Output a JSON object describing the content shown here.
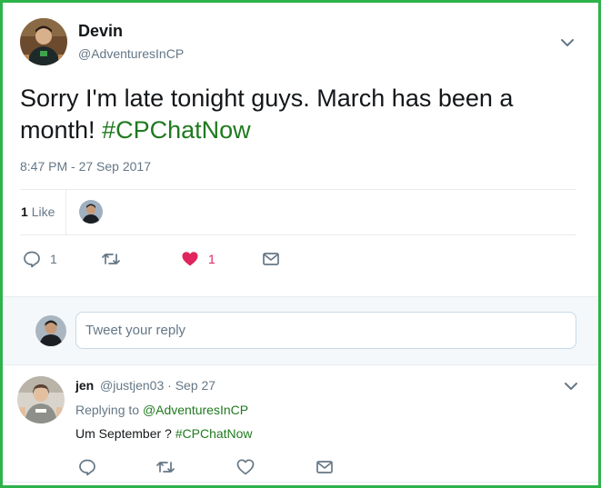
{
  "tweet": {
    "author_name": "Devin",
    "author_handle": "@AdventuresInCP",
    "text": "Sorry I'm late tonight guys. March has been a month!",
    "hashtag": "#CPChatNow",
    "timestamp": "8:47 PM - 27 Sep 2017",
    "likes_count": "1",
    "likes_label": "Like",
    "reply_count": "1",
    "like_action_count": "1"
  },
  "reply_box": {
    "placeholder": "Tweet your reply"
  },
  "reply_tweet": {
    "author_name": "jen",
    "meta": "@justjen03 · Sep 27",
    "replying_to_label": "Replying to",
    "replying_to_handle": "@AdventuresInCP",
    "text": "Um September ?",
    "hashtag": "#CPChatNow"
  },
  "icons": {
    "reply": "reply-icon",
    "retweet": "retweet-icon",
    "like": "heart-icon",
    "dm": "envelope-icon",
    "menu": "chevron-down-icon"
  },
  "colors": {
    "frame_border": "#2db34a",
    "hashtag": "#1f7a1f",
    "like_active": "#e0245e",
    "secondary_text": "#657786"
  }
}
